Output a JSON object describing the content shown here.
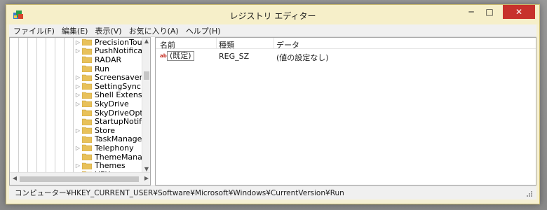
{
  "window": {
    "title": "レジストリ エディター",
    "controls": {
      "minimize": "─",
      "maximize": "□",
      "close": "✕"
    }
  },
  "menu": [
    "ファイル(F)",
    "編集(E)",
    "表示(V)",
    "お気に入り(A)",
    "ヘルプ(H)"
  ],
  "tree": {
    "items": [
      {
        "label": "PrecisionTouchPad",
        "expandable": true
      },
      {
        "label": "PushNotifications",
        "expandable": true
      },
      {
        "label": "RADAR",
        "expandable": false
      },
      {
        "label": "Run",
        "expandable": false,
        "selected": true
      },
      {
        "label": "Screensavers",
        "expandable": true
      },
      {
        "label": "SettingSync",
        "expandable": true
      },
      {
        "label": "Shell Extensions",
        "expandable": true
      },
      {
        "label": "SkyDrive",
        "expandable": true
      },
      {
        "label": "SkyDriveOptIn",
        "expandable": false
      },
      {
        "label": "StartupNotify",
        "expandable": false
      },
      {
        "label": "Store",
        "expandable": true
      },
      {
        "label": "TaskManager",
        "expandable": false
      },
      {
        "label": "Telephony",
        "expandable": true
      },
      {
        "label": "ThemeManager",
        "expandable": false
      },
      {
        "label": "Themes",
        "expandable": true
      },
      {
        "label": "UFH",
        "expandable": true
      }
    ]
  },
  "list": {
    "columns": {
      "name": "名前",
      "type": "種類",
      "data": "データ"
    },
    "rows": [
      {
        "icon": "string-value-icon",
        "icon_text": "ab",
        "name": "(既定)",
        "type": "REG_SZ",
        "data": "(値の設定なし)"
      }
    ]
  },
  "status": {
    "path": "コンピューター¥HKEY_CURRENT_USER¥Software¥Microsoft¥Windows¥CurrentVersion¥Run"
  },
  "colors": {
    "titlebar": "#f6efc9",
    "close_button": "#c7322c",
    "folder": "#e8c15a"
  }
}
